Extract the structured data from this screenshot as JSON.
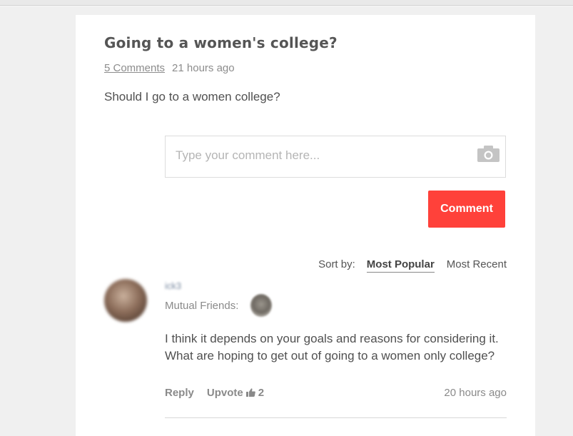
{
  "post": {
    "title": "Going to a women's college?",
    "comments_link": "5 Comments",
    "time_ago": "21 hours ago",
    "body": "Should I go to a women college?"
  },
  "composer": {
    "placeholder": "Type your comment here...",
    "camera_icon": "camera-icon",
    "submit_label": "Comment",
    "accent_color": "#ff413a"
  },
  "sort": {
    "label": "Sort by:",
    "options": [
      {
        "label": "Most Popular",
        "active": true
      },
      {
        "label": "Most Recent",
        "active": false
      }
    ]
  },
  "comment": {
    "username": "ick3",
    "mutual_label": "Mutual Friends:",
    "text": "I think it depends on your goals and reasons for considering it. What are hoping to get out of going to a women only college?",
    "reply_label": "Reply",
    "upvote_label": "Upvote",
    "upvote_icon": "thumbs-up-icon",
    "upvote_count": "2",
    "time_ago": "20 hours ago"
  }
}
